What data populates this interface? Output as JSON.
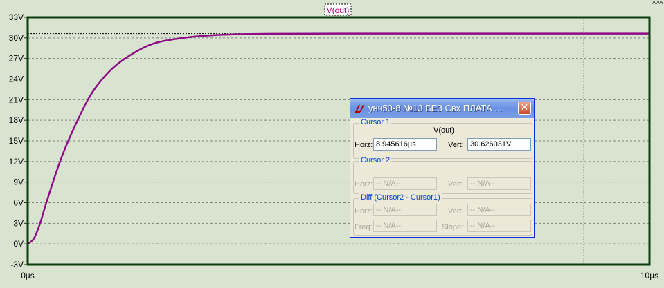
{
  "plot": {
    "trace_name": "V(out)",
    "y_ticks": [
      "33V",
      "30V",
      "27V",
      "24V",
      "21V",
      "18V",
      "15V",
      "12V",
      "9V",
      "6V",
      "3V",
      "0V",
      "-3V"
    ],
    "x_ticks": [
      "0µs",
      "10µs"
    ],
    "colors": {
      "background": "#d8e4d0",
      "frame": "#0a3d0a",
      "trace": "#8e0a86",
      "grid": "#808080",
      "cursor": "#000000"
    }
  },
  "chart_data": {
    "type": "line",
    "x_unit": "µs",
    "y_unit": "V",
    "xlim": [
      0,
      10
    ],
    "ylim": [
      -3,
      33
    ],
    "grid": true,
    "series": [
      {
        "name": "V(out)",
        "x": [
          0,
          0.1,
          0.2,
          0.3,
          0.5,
          0.7,
          1.0,
          1.3,
          1.6,
          2.0,
          2.5,
          3.0,
          3.5,
          4.0,
          5.0,
          6.0,
          7.0,
          8.0,
          9.0,
          10.0
        ],
        "y": [
          0,
          0.8,
          3.0,
          6.0,
          11.5,
          16.0,
          21.5,
          25.0,
          27.2,
          29.1,
          30.0,
          30.4,
          30.55,
          30.6,
          30.62,
          30.626,
          30.626,
          30.626,
          30.626,
          30.626
        ]
      }
    ],
    "cursor": {
      "x": 8.945616,
      "y": 30.626031
    }
  },
  "dialog": {
    "title": "унч50-8  №13  БЕЗ Свх ПЛАТА ...",
    "close_label": "✕",
    "cursor1": {
      "legend": "Cursor 1",
      "trace": "V(out)",
      "horz_label": "Horz:",
      "horz_value": "8.945616µs",
      "vert_label": "Vert:",
      "vert_value": "30.626031V"
    },
    "cursor2": {
      "legend": "Cursor 2",
      "horz_label": "Horz:",
      "horz_value": "-- N/A--",
      "vert_label": "Vert:",
      "vert_value": "-- N/A--"
    },
    "diff": {
      "legend": "Diff (Cursor2 - Cursor1)",
      "horz_label": "Horz:",
      "horz_value": "-- N/A--",
      "vert_label": "Vert:",
      "vert_value": "-- N/A--",
      "freq_label": "Freq:",
      "freq_value": "-- N/A--",
      "slope_label": "Slope:",
      "slope_value": "-- N/A--"
    }
  }
}
